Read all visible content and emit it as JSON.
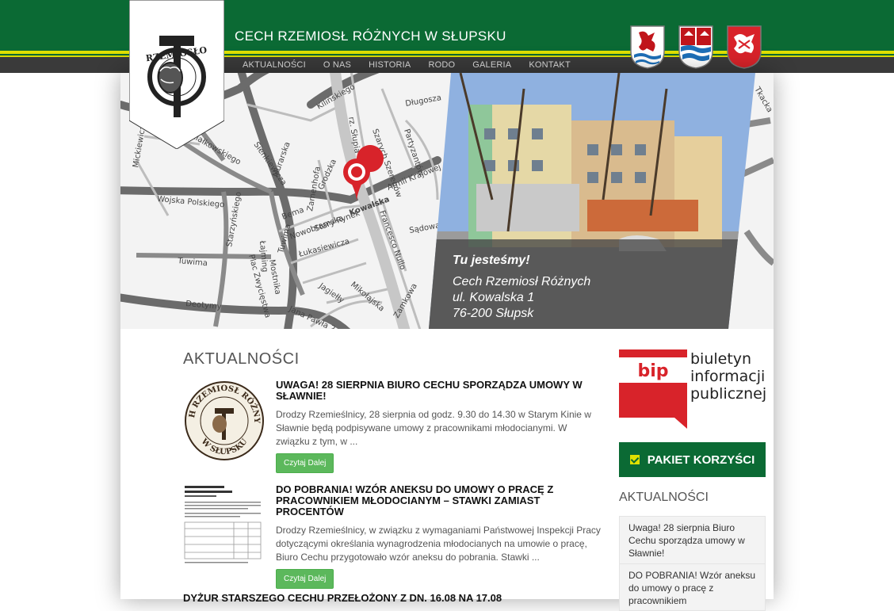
{
  "header": {
    "site_title": "CECH RZEMIOSŁ RÓŻNYCH W SŁUPSKU",
    "logo_text": "RZEMIOSŁO",
    "nav": [
      "AKTUALNOŚCI",
      "O NAS",
      "HISTORIA",
      "RODO",
      "GALERIA",
      "KONTAKT"
    ]
  },
  "hero": {
    "streets": [
      "Kilińskiego",
      "rz. Słupia",
      "Długosza",
      "Szarych Szeregów",
      "Partyzantów",
      "Mickiewicza",
      "Niedziałkowskiego",
      "Sienkiewicza",
      "Murarska",
      "Grodzka",
      "Zamenhofa",
      "Armii Krajowej",
      "Wojska Polskiego",
      "Starzyńskiego",
      "Bema",
      "Nowobramska",
      "Stary Rynek",
      "Kowalska",
      "Francesco Nullo",
      "Sądowa",
      "Tuwima",
      "Łajming",
      "Tuwima",
      "Mostnika",
      "Łukasiewicza",
      "Plac Zwycięstwa",
      "Jagiełły",
      "Mikołajska",
      "Deotymy",
      "Jana Pawła 2",
      "Zamkowa",
      "Tkacka"
    ],
    "caption_tag": "Tu jesteśmy!",
    "caption_lines": [
      "Cech Rzemiosł Różnych",
      "ul. Kowalska 1",
      "76-200 Słupsk"
    ]
  },
  "main": {
    "section_title": "AKTUALNOŚCI",
    "articles": [
      {
        "title": "UWAGA! 28 SIERPNIA BIURO CECHU SPORZĄDZA UMOWY W SŁAWNIE!",
        "excerpt": "Drodzy Rzemieślnicy, 28 sierpnia od godz. 9.30 do 14.30 w Starym Kinie w Sławnie będą podpisywane umowy z pracownikami młodocianymi. W związku z tym, w ...",
        "button": "Czytaj Dalej",
        "thumb_text_top": "CECH RZEMIOSŁ RÓŻNYCH",
        "thumb_text_bottom": "W SŁUPSKU"
      },
      {
        "title": "DO POBRANIA! WZÓR ANEKSU DO UMOWY O PRACĘ Z PRACOWNIKIEM MŁODOCIANYM – STAWKI ZAMIAST PROCENTÓW",
        "excerpt": "Drodzy Rzemieślnicy, w związku z wymaganiami Państwowej Inspekcji Pracy dotyczącymi określania wynagrodzenia młodocianych na umowie o pracę, Biuro Cechu przygotowało wzór aneksu do pobrania. Stawki ...",
        "button": "Czytaj Dalej"
      },
      {
        "title": "DYŻUR STARSZEGO CECHU PRZEŁOŻONY Z DN. 16.08 NA 17.08"
      }
    ]
  },
  "sidebar": {
    "bip_logo": "bip",
    "bip_text": [
      "biuletyn",
      "informacji",
      "publicznej"
    ],
    "pakiet_label": "PAKIET KORZYŚCI",
    "section_title": "AKTUALNOŚCI",
    "items": [
      "Uwaga! 28 sierpnia Biuro Cechu sporządza umowy w Sławnie!",
      "DO POBRANIA! Wzór aneksu do umowy o pracę z pracownikiem"
    ]
  },
  "colors": {
    "brand_green": "#0b6a34",
    "accent_yellow": "#e0e000",
    "nav_dark": "#3a3a3a",
    "button_green": "#5cb85c",
    "bip_red": "#d8232a"
  }
}
